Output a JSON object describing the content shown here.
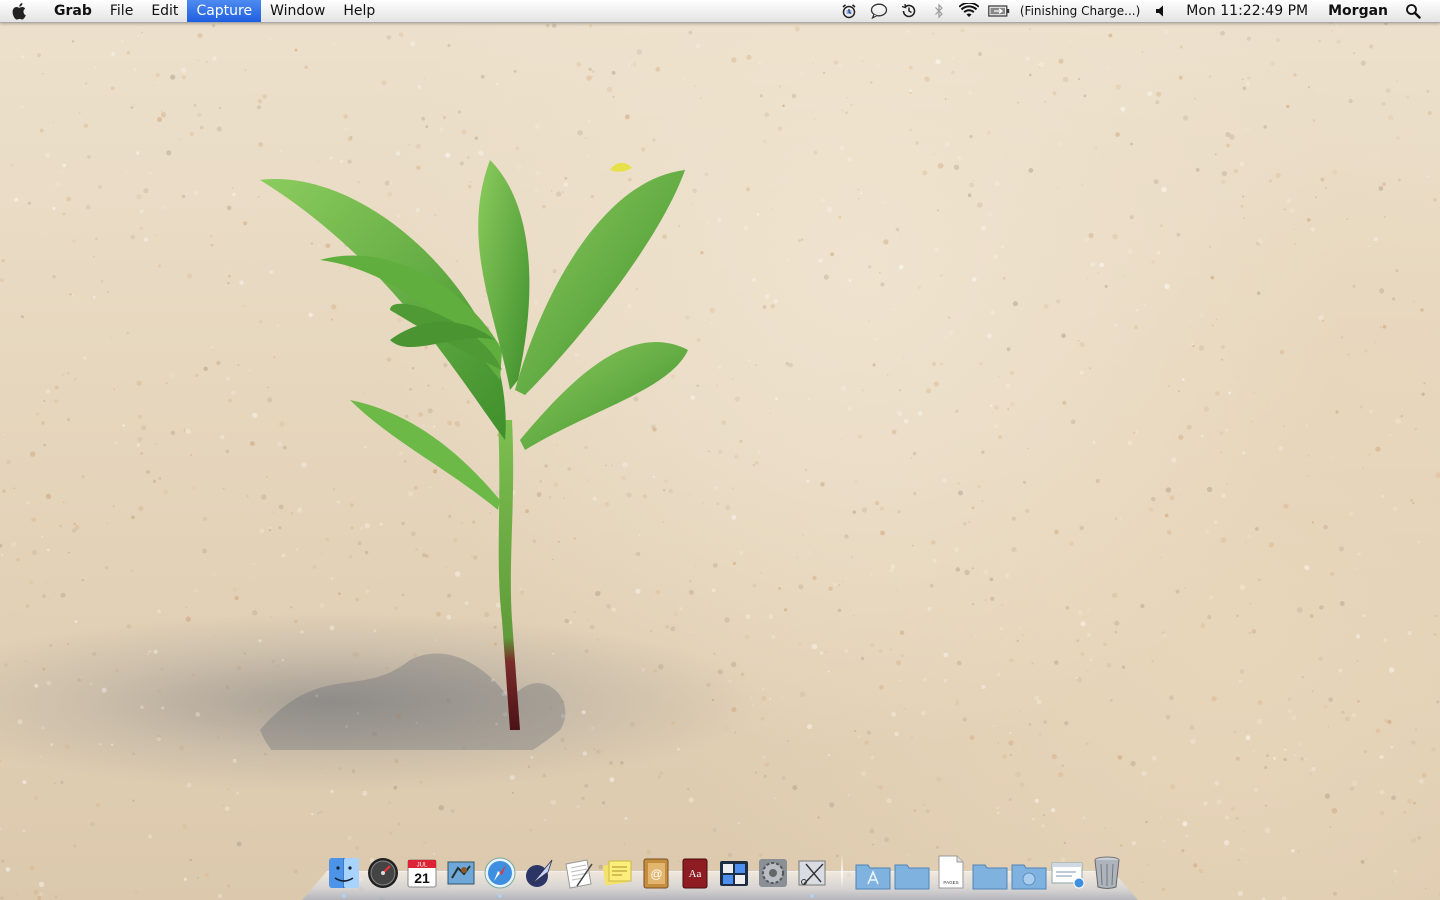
{
  "menubar": {
    "apple_icon": "apple-logo-icon",
    "app_name": "Grab",
    "menus": [
      "File",
      "Edit",
      "Capture",
      "Window",
      "Help"
    ],
    "active_menu": "Capture",
    "status": {
      "battery_text": "(Finishing Charge...)",
      "clock": "Mon 11:22:49 PM",
      "user": "Morgan"
    },
    "status_icons": [
      "alarm-clock-icon",
      "chat-bubble-icon",
      "time-machine-icon",
      "bluetooth-icon",
      "wifi-icon",
      "battery-icon",
      "volume-icon",
      "spotlight-icon"
    ]
  },
  "dock": {
    "apps": [
      {
        "name": "finder-icon",
        "running": true
      },
      {
        "name": "dashboard-icon",
        "running": false
      },
      {
        "name": "calendar-icon",
        "running": false,
        "month": "JUL",
        "day": "21"
      },
      {
        "name": "mail-icon",
        "running": false
      },
      {
        "name": "safari-icon",
        "running": true
      },
      {
        "name": "quill-app-icon",
        "running": false
      },
      {
        "name": "textedit-icon",
        "running": false
      },
      {
        "name": "stickies-icon",
        "running": false
      },
      {
        "name": "address-book-icon",
        "running": false,
        "glyph": "@"
      },
      {
        "name": "dictionary-icon",
        "running": false,
        "glyph": "Aa"
      },
      {
        "name": "spaces-icon",
        "running": false
      },
      {
        "name": "system-preferences-icon",
        "running": false
      },
      {
        "name": "grab-icon",
        "running": true
      }
    ],
    "stacks": [
      {
        "name": "applications-folder-icon"
      },
      {
        "name": "documents-folder-icon"
      },
      {
        "name": "pages-document-icon",
        "label": "PAGES"
      },
      {
        "name": "folder-icon"
      },
      {
        "name": "downloads-folder-icon"
      },
      {
        "name": "network-window-icon"
      },
      {
        "name": "trash-icon"
      }
    ]
  },
  "colors": {
    "menu_highlight": "#2a6ae6",
    "sand": "#e6d6bd",
    "leaf": "#5aa83e",
    "stem": "#6b1a22"
  }
}
